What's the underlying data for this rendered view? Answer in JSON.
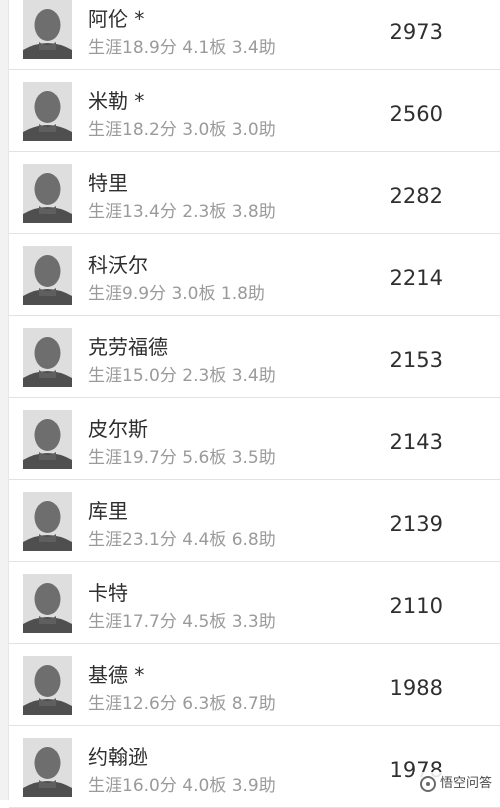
{
  "players": [
    {
      "name": "阿伦 *",
      "stats": "生涯18.9分 4.1板 3.4助",
      "score": "2973",
      "avatar_icon": "player-headshot"
    },
    {
      "name": "米勒 *",
      "stats": "生涯18.2分 3.0板 3.0助",
      "score": "2560",
      "avatar_icon": "player-headshot"
    },
    {
      "name": "特里",
      "stats": "生涯13.4分 2.3板 3.8助",
      "score": "2282",
      "avatar_icon": "player-headshot"
    },
    {
      "name": "科沃尔",
      "stats": "生涯9.9分 3.0板 1.8助",
      "score": "2214",
      "avatar_icon": "player-headshot"
    },
    {
      "name": "克劳福德",
      "stats": "生涯15.0分 2.3板 3.4助",
      "score": "2153",
      "avatar_icon": "player-headshot"
    },
    {
      "name": "皮尔斯",
      "stats": "生涯19.7分 5.6板 3.5助",
      "score": "2143",
      "avatar_icon": "player-headshot"
    },
    {
      "name": "库里",
      "stats": "生涯23.1分 4.4板 6.8助",
      "score": "2139",
      "avatar_icon": "player-headshot"
    },
    {
      "name": "卡特",
      "stats": "生涯17.7分 4.5板 3.3助",
      "score": "2110",
      "avatar_icon": "player-headshot"
    },
    {
      "name": "基德 *",
      "stats": "生涯12.6分 6.3板 8.7助",
      "score": "1988",
      "avatar_icon": "player-headshot"
    },
    {
      "name": "约翰逊",
      "stats": "生涯16.0分 4.0板 3.9助",
      "score": "1978",
      "avatar_icon": "player-headshot"
    }
  ],
  "watermark": {
    "text": "悟空问答",
    "icon": "wukong-logo-icon"
  }
}
